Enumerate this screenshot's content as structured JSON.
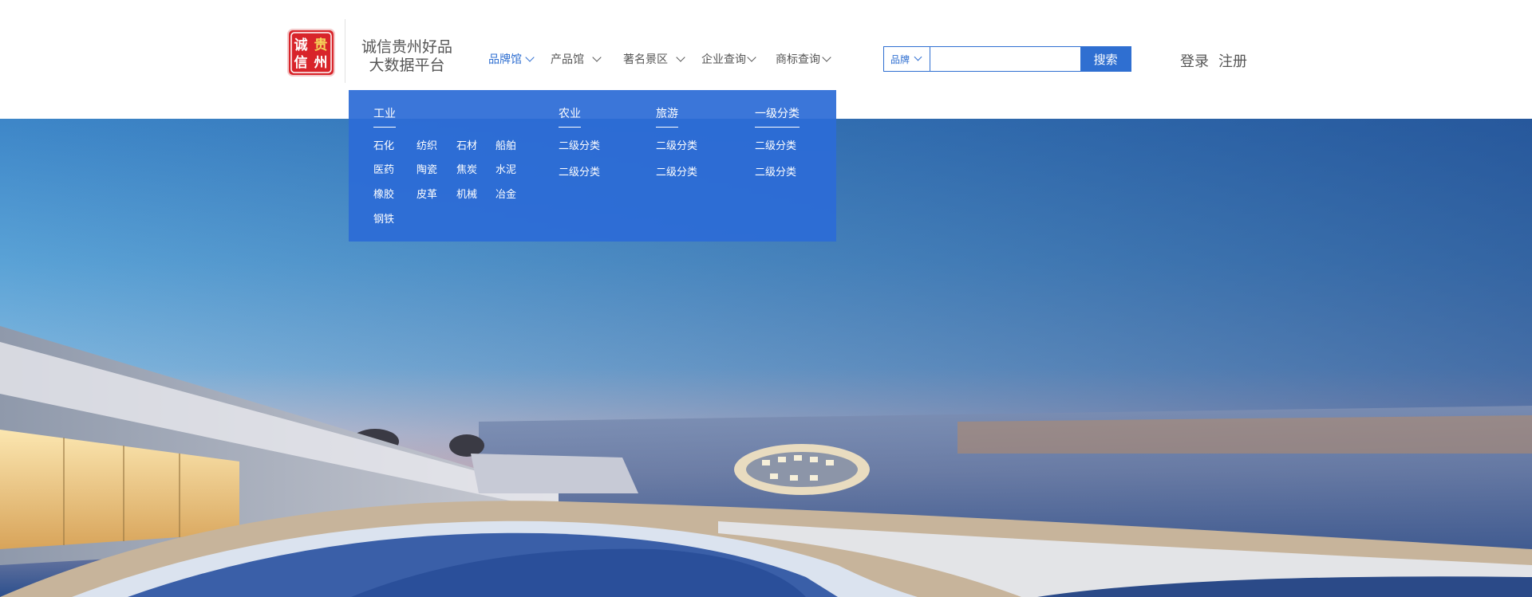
{
  "logo": {
    "seal_text": [
      "诚",
      "信",
      "贵",
      "州"
    ]
  },
  "brand": {
    "line1": "诚信贵州好品",
    "line2": "大数据平台"
  },
  "nav": [
    {
      "label": "品牌馆",
      "active": true
    },
    {
      "label": "产品馆",
      "active": false
    },
    {
      "label": "著名景区",
      "active": false
    },
    {
      "label": "企业查询",
      "active": false
    },
    {
      "label": "商标查询",
      "active": false
    }
  ],
  "search": {
    "type_label": "品牌",
    "placeholder": "",
    "value": "",
    "button_label": "搜索"
  },
  "auth": {
    "login": "登录",
    "register": "注册"
  },
  "dropdown": {
    "columns": [
      {
        "title": "工业",
        "items": [
          "石化",
          "纺织",
          "石材",
          "船舶",
          "医药",
          "陶瓷",
          "焦炭",
          "水泥",
          "橡胶",
          "皮革",
          "机械",
          "冶金",
          "钢铁"
        ]
      },
      {
        "title": "农业",
        "items": [
          "二级分类",
          "二级分类"
        ]
      },
      {
        "title": "旅游",
        "items": [
          "二级分类",
          "二级分类"
        ]
      },
      {
        "title": "一级分类",
        "items": [
          "二级分类",
          "二级分类"
        ]
      }
    ]
  },
  "colors": {
    "accent": "#2f6fd1",
    "seal_red": "#d8242a",
    "dropdown_bg": "#2c6cd6"
  }
}
